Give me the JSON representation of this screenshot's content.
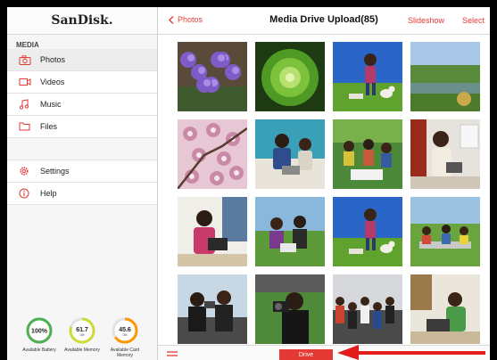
{
  "sidebar": {
    "logo": "SanDisk.",
    "section_label": "MEDIA",
    "items": [
      {
        "label": "Photos",
        "icon": "camera-icon",
        "active": true
      },
      {
        "label": "Videos",
        "icon": "video-camera-icon"
      },
      {
        "label": "Music",
        "icon": "music-note-icon"
      },
      {
        "label": "Files",
        "icon": "folder-icon"
      }
    ],
    "settings_items": [
      {
        "label": "Settings",
        "icon": "gear-icon"
      },
      {
        "label": "Help",
        "icon": "info-icon"
      }
    ],
    "gauges": [
      {
        "value": "100%",
        "unit": "",
        "label": "Available Battery",
        "fraction": 1.0
      },
      {
        "value": "61.7",
        "unit": "GB",
        "label": "Available Memory",
        "fraction": 0.8
      },
      {
        "value": "45.6",
        "unit": "GB",
        "label": "Available Card Memory",
        "fraction": 0.65
      }
    ]
  },
  "topbar": {
    "back_label": "Photos",
    "title": "Media Drive Upload(85)",
    "slideshow_label": "Slideshow",
    "select_label": "Select"
  },
  "bottombar": {
    "drive_label": "Drive"
  },
  "colors": {
    "accent": "#e53935",
    "gauge_green": "#4caf50",
    "gauge_yellow": "#cddc39",
    "gauge_orange": "#ff9800"
  },
  "photos": [
    "purple-lavender-flowers",
    "green-succulent-plant",
    "girl-with-dog-on-lawn",
    "countryside-pond-landscape",
    "pink-cherry-blossoms",
    "students-with-laptop",
    "group-outdoors-on-grass",
    "woman-reading-tablet",
    "girl-with-tablet-indoors",
    "women-on-grass-with-tablet",
    "girl-with-dog-on-lawn",
    "group-at-picnic-table",
    "people-taking-photos",
    "photographer-with-camera",
    "crowd-at-event",
    "woman-with-laptop-indoors"
  ]
}
